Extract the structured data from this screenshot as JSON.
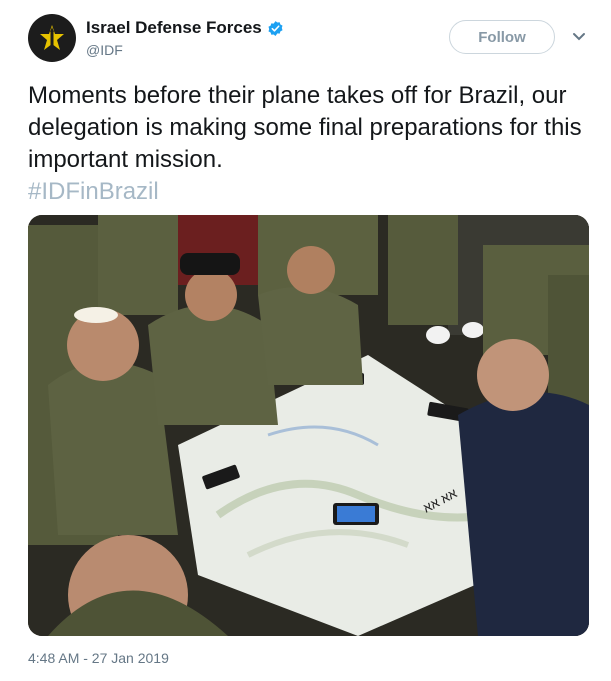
{
  "account": {
    "display_name": "Israel Defense Forces",
    "handle": "@IDF",
    "verified": true,
    "avatar_icon": "idf-emblem-icon",
    "accent_color": "#e6c200"
  },
  "follow": {
    "label": "Follow"
  },
  "menu": {
    "icon": "chevron-down-icon"
  },
  "tweet": {
    "text": "Moments before their plane takes off for Brazil, our delegation is making some final preparations for this important mission.",
    "hashtag": "#IDFinBrazil"
  },
  "photo": {
    "caption_icon": "photo-of-delegation-around-map",
    "map_handwriting": "ﬡﬡ ﬡﬡ"
  },
  "meta": {
    "timestamp": "4:48 AM - 27 Jan 2019"
  },
  "colors": {
    "link": "#1da1f2",
    "muted": "#657786",
    "hashtag": "#a6b8c6"
  }
}
